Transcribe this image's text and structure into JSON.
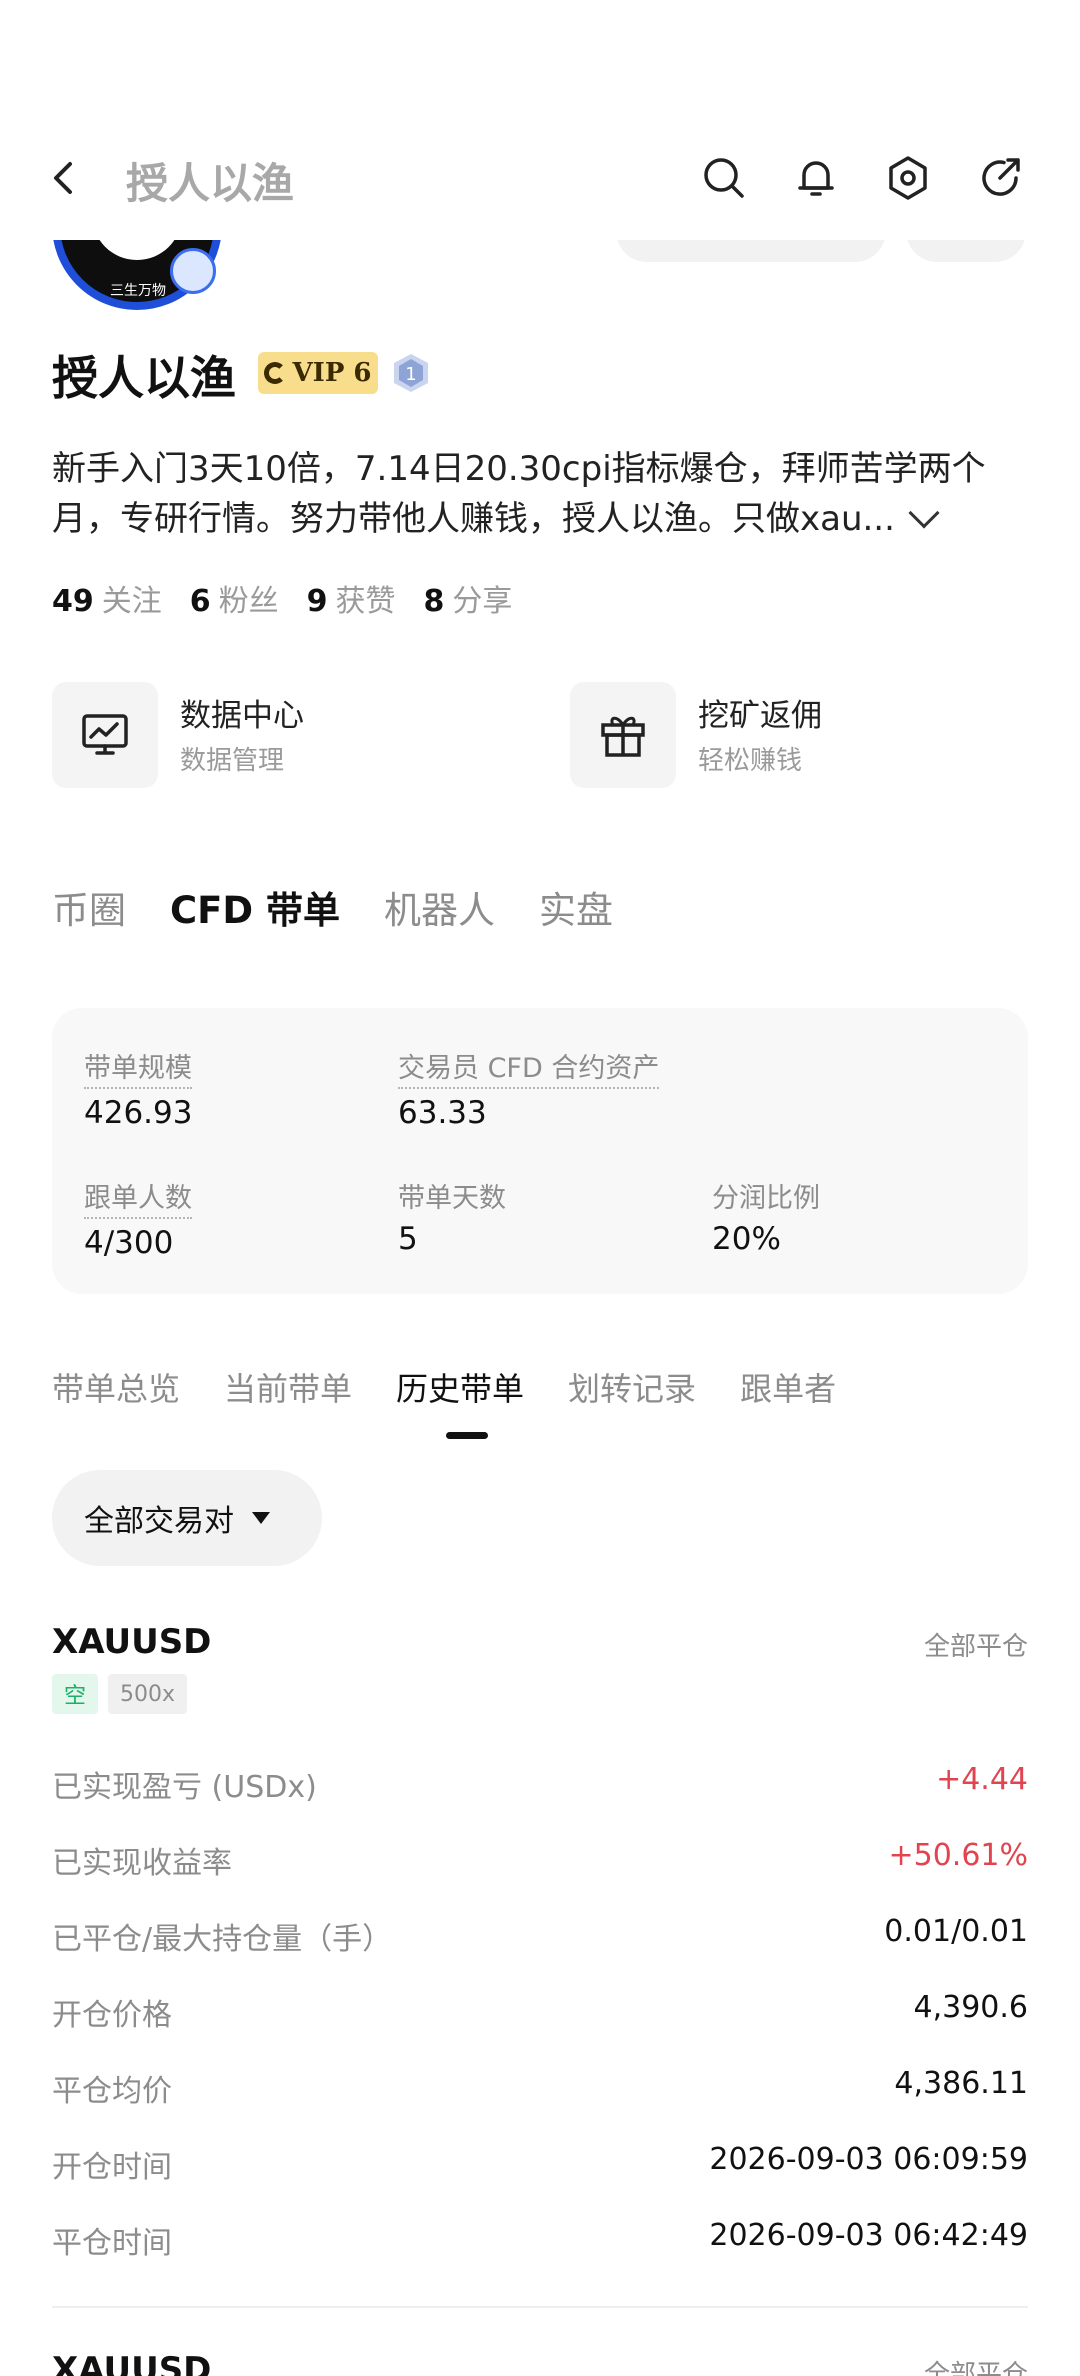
{
  "header": {
    "title": "授人以渔",
    "icons": [
      "back-arrow-icon",
      "search-icon",
      "bell-icon",
      "hex-settings-icon",
      "share-icon"
    ]
  },
  "profile": {
    "avatar_text": "三生万物",
    "name": "授人以渔",
    "vip_label": "VIP 6",
    "level": "1",
    "bio": "新手入门3天10倍，7.14日20.30cpi指标爆仓，拜师苦学两个月，专研行情。努力带他人赚钱，授人以渔。只做xau...",
    "stats": [
      {
        "num": "49",
        "label": "关注"
      },
      {
        "num": "6",
        "label": "粉丝"
      },
      {
        "num": "9",
        "label": "获赞"
      },
      {
        "num": "8",
        "label": "分享"
      }
    ]
  },
  "tools": [
    {
      "title": "数据中心",
      "subtitle": "数据管理",
      "icon": "chart-monitor-icon"
    },
    {
      "title": "挖矿返佣",
      "subtitle": "轻松赚钱",
      "icon": "gift-icon"
    }
  ],
  "main_tabs": [
    "币圈",
    "CFD 带单",
    "机器人",
    "实盘"
  ],
  "main_tab_active": 1,
  "summary": {
    "scale_label": "带单规模",
    "scale_value": "426.93",
    "assets_label": "交易员 CFD 合约资产",
    "assets_value": "63.33",
    "followers_label": "跟单人数",
    "followers_value": "4/300",
    "days_label": "带单天数",
    "days_value": "5",
    "share_label": "分润比例",
    "share_value": "20%"
  },
  "sub_tabs": [
    "带单总览",
    "当前带单",
    "历史带单",
    "划转记录",
    "跟单者"
  ],
  "sub_tab_active": 2,
  "filter": {
    "label": "全部交易对"
  },
  "position": {
    "symbol": "XAUUSD",
    "close_all": "全部平仓",
    "side": "空",
    "leverage": "500x",
    "rows": [
      {
        "label": "已实现盈亏 (USDx)",
        "value": "+4.44",
        "red": true
      },
      {
        "label": "已实现收益率",
        "value": "+50.61%",
        "red": true
      },
      {
        "label": "已平仓/最大持仓量（手）",
        "value": "0.01/0.01"
      },
      {
        "label": "开仓价格",
        "value": "4,390.6"
      },
      {
        "label": "平仓均价",
        "value": "4,386.11"
      },
      {
        "label": "开仓时间",
        "value": "2026-09-03 06:09:59"
      },
      {
        "label": "平仓时间",
        "value": "2026-09-03 06:42:49"
      }
    ]
  },
  "next_position": {
    "symbol": "XAUUSD",
    "close_all": "全部平仓"
  },
  "colors": {
    "profit_red": "#e2444f",
    "short_green": "#1bb06a",
    "vip_gold": "#f8dd8c"
  }
}
